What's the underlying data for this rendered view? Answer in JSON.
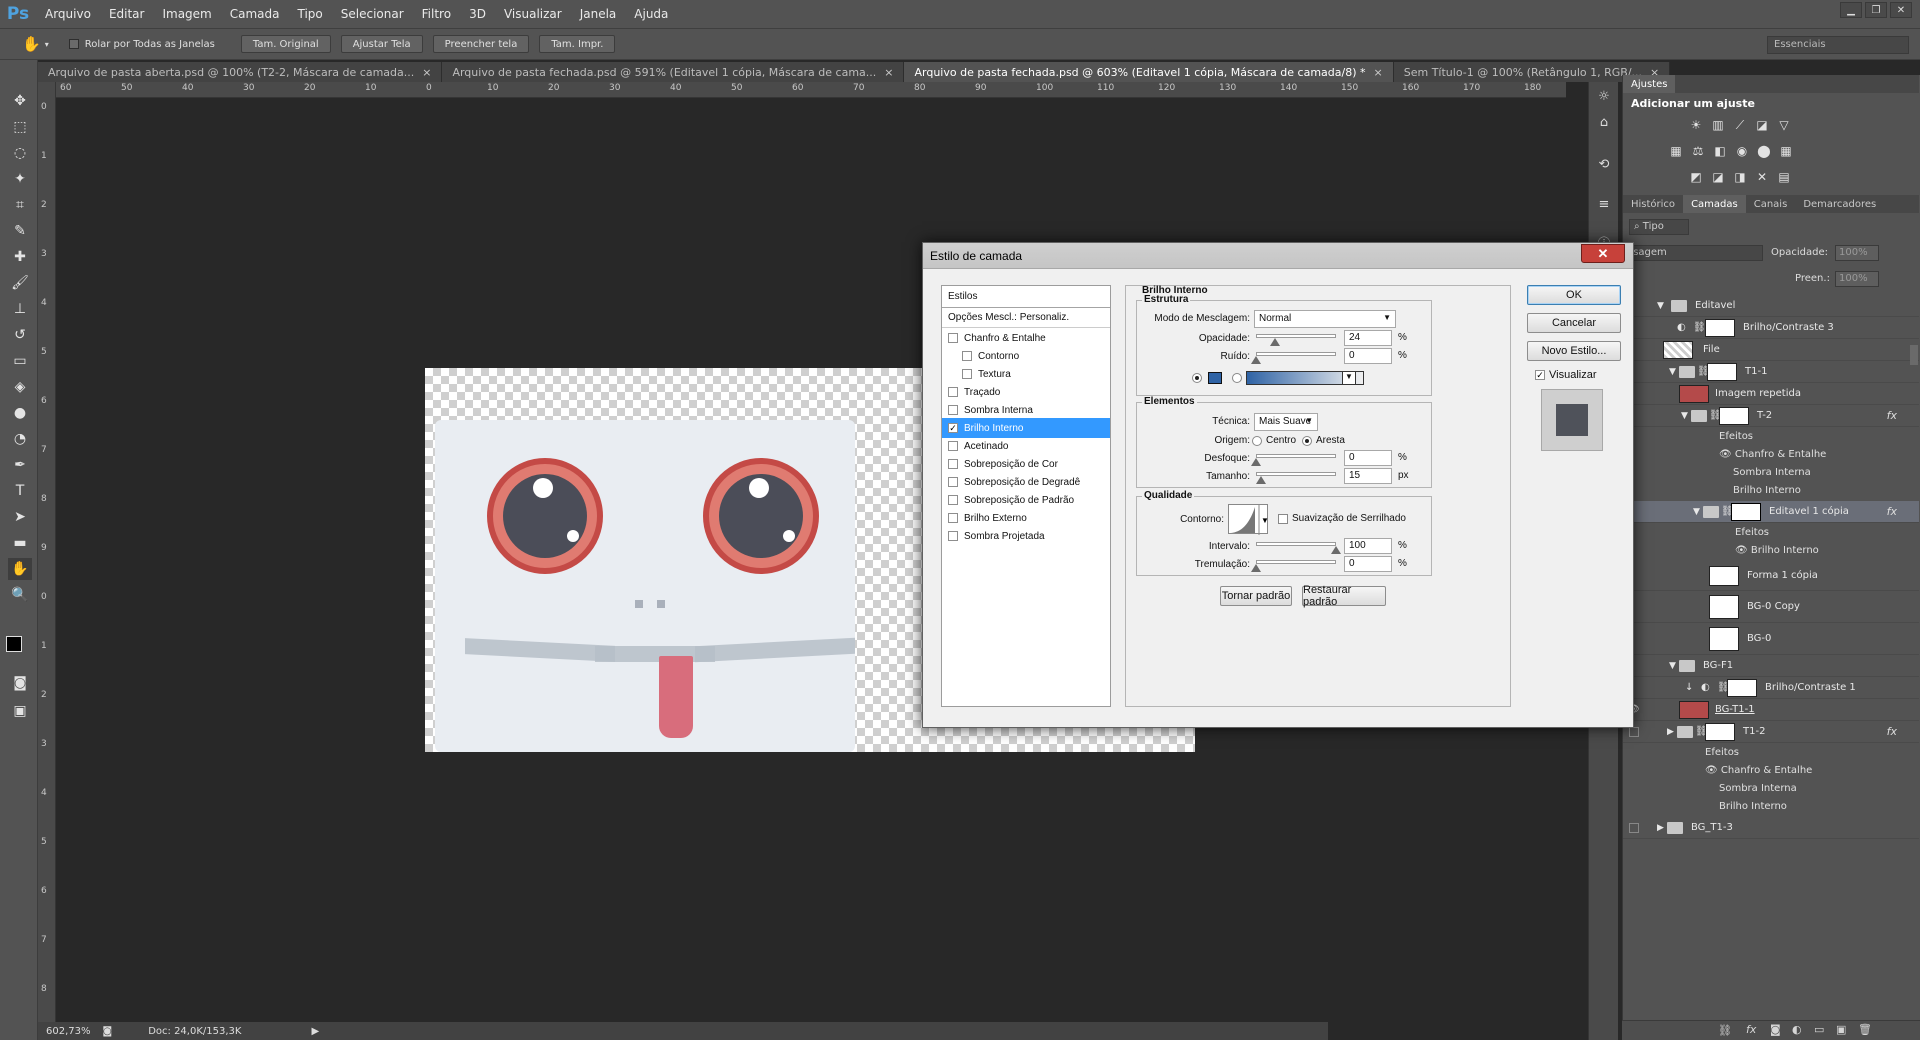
{
  "app": {
    "logo": "Ps"
  },
  "menu": [
    "Arquivo",
    "Editar",
    "Imagem",
    "Camada",
    "Tipo",
    "Selecionar",
    "Filtro",
    "3D",
    "Visualizar",
    "Janela",
    "Ajuda"
  ],
  "options": {
    "scroll_all": "Rolar por Todas as Janelas",
    "btn_actual": "Tam. Original",
    "btn_fit": "Ajustar Tela",
    "btn_fill": "Preencher tela",
    "btn_print": "Tam. Impr.",
    "workspace": "Essenciais"
  },
  "tabs": [
    {
      "label": "Arquivo de pasta aberta.psd @ 100% (T2-2, Máscara de camada..."
    },
    {
      "label": "Arquivo de pasta fechada.psd @ 591% (Editavel 1 cópia, Máscara de cama..."
    },
    {
      "label": "Arquivo de pasta fechada.psd @ 603% (Editavel 1 cópia, Máscara de camada/8) *"
    },
    {
      "label": "Sem Título-1 @ 100% (Retângulo 1, RGB/..."
    }
  ],
  "ruler_h": [
    "60",
    "50",
    "40",
    "30",
    "20",
    "10",
    "0",
    "10",
    "20",
    "30",
    "40",
    "50",
    "60",
    "70",
    "80",
    "90",
    "100",
    "110",
    "120",
    "130",
    "140",
    "150",
    "160",
    "170",
    "180"
  ],
  "ruler_v": [
    "0",
    "1",
    "2",
    "3",
    "4",
    "5",
    "6",
    "7",
    "8",
    "9",
    "0",
    "1",
    "2",
    "3",
    "4",
    "5",
    "6",
    "7",
    "8",
    "9"
  ],
  "status": {
    "zoom": "602,73%",
    "doc": "Doc: 24,0K/153,3K"
  },
  "panels": {
    "adjust_tab": "Ajustes",
    "adjust_title": "Adicionar um ajuste",
    "layer_tabs": [
      "Histórico",
      "Camadas",
      "Canais",
      "Demarcadores"
    ],
    "filter_kind": "Tipo",
    "blend_mode": "ssagem",
    "opacity_label": "Opacidade:",
    "opacity_value": "100%",
    "fill_label": "Preen.:",
    "fill_value": "100%"
  },
  "layers": [
    {
      "name": "Editavel"
    },
    {
      "name": "Brilho/Contraste 3"
    },
    {
      "name": "File"
    },
    {
      "name": "T1-1"
    },
    {
      "name": "Imagem repetida"
    },
    {
      "name": "T-2"
    },
    {
      "name": "Efeitos"
    },
    {
      "name": "Chanfro & Entalhe"
    },
    {
      "name": "Sombra Interna"
    },
    {
      "name": "Brilho Interno"
    },
    {
      "name": "Editavel 1 cópia"
    },
    {
      "name": "Efeitos"
    },
    {
      "name": "Brilho Interno"
    },
    {
      "name": "Forma 1 cópia"
    },
    {
      "name": "BG-0 Copy"
    },
    {
      "name": "BG-0"
    },
    {
      "name": "BG-F1"
    },
    {
      "name": "Brilho/Contraste 1"
    },
    {
      "name": "BG-T1-1"
    },
    {
      "name": "T1-2"
    },
    {
      "name": "Efeitos"
    },
    {
      "name": "Chanfro & Entalhe"
    },
    {
      "name": "Sombra Interna"
    },
    {
      "name": "Brilho Interno"
    },
    {
      "name": "BG_T1-3"
    }
  ],
  "dialog": {
    "title": "Estilo de camada",
    "close": "✕",
    "styles_header": "Estilos",
    "blend_options": "Opções Mescl.: Personaliz.",
    "styles": [
      {
        "label": "Chanfro & Entalhe",
        "checked": ""
      },
      {
        "label": "Contorno",
        "checked": ""
      },
      {
        "label": "Textura",
        "checked": ""
      },
      {
        "label": "Traçado",
        "checked": ""
      },
      {
        "label": "Sombra Interna",
        "checked": ""
      },
      {
        "label": "Brilho Interno",
        "checked": "✓"
      },
      {
        "label": "Acetinado",
        "checked": ""
      },
      {
        "label": "Sobreposição de Cor",
        "checked": ""
      },
      {
        "label": "Sobreposição de Degradê",
        "checked": ""
      },
      {
        "label": "Sobreposição de Padrão",
        "checked": ""
      },
      {
        "label": "Brilho Externo",
        "checked": ""
      },
      {
        "label": "Sombra Projetada",
        "checked": ""
      }
    ],
    "section_title": "Brilho Interno",
    "structure": "Estrutura",
    "blend_mode_label": "Modo de Mesclagem:",
    "blend_mode_value": "Normal",
    "opacity_label": "Opacidade:",
    "opacity_value": "24",
    "opacity_level": 0.24,
    "noise_label": "Ruído:",
    "noise_value": "0",
    "noise_level": 0,
    "elements": "Elementos",
    "technique_label": "Técnica:",
    "technique_value": "Mais Suave",
    "source_label": "Origem:",
    "source_center": "Centro",
    "source_edge": "Aresta",
    "choke_label": "Desfoque:",
    "choke_value": "0",
    "choke_level": 0,
    "size_label": "Tamanho:",
    "size_value": "15",
    "size_level": 0.06,
    "quality": "Qualidade",
    "contour_label": "Contorno:",
    "antialias_label": "Suavização de Serrilhado",
    "range_label": "Intervalo:",
    "range_value": "100",
    "range_level": 1,
    "jitter_label": "Tremulação:",
    "jitter_value": "0",
    "jitter_level": 0,
    "unit_pct": "%",
    "unit_px": "px",
    "btn_default": "Tornar padrão",
    "btn_reset": "Restaurar padrão",
    "btn_ok": "OK",
    "btn_cancel": "Cancelar",
    "btn_new_style": "Novo Estilo...",
    "preview_label": "Visualizar",
    "glow_color": "#2f63a5"
  }
}
